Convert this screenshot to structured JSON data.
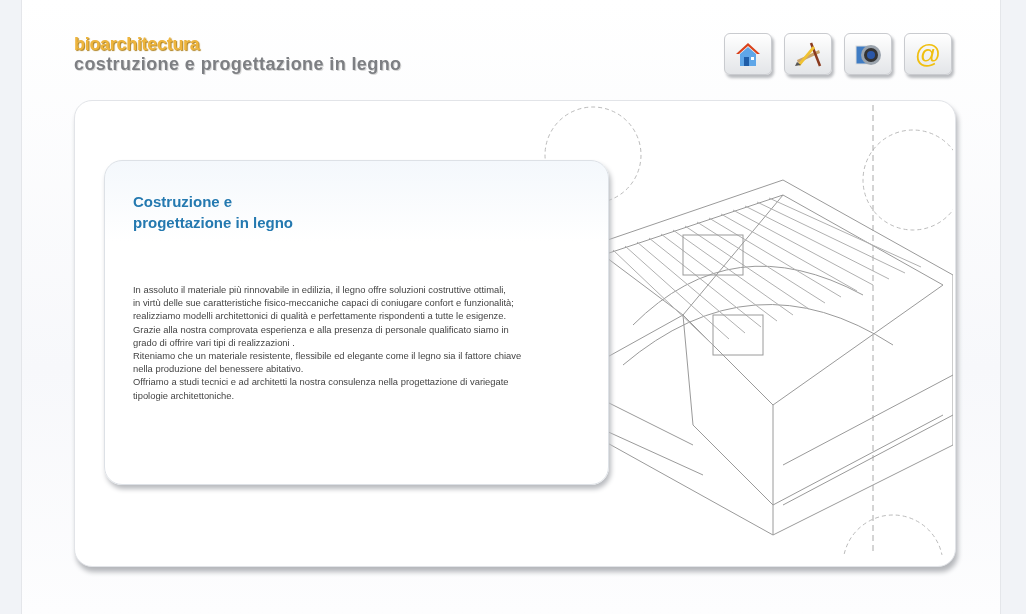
{
  "header": {
    "brand": "bioarchitectura",
    "tagline": "costruzione e progettazione in legno"
  },
  "nav": [
    {
      "kind": "house"
    },
    {
      "kind": "tools"
    },
    {
      "kind": "camera"
    },
    {
      "kind": "at",
      "glyph": "@"
    }
  ],
  "content": {
    "title_lines": [
      "Costruzione e",
      "progettazione in legno"
    ],
    "lines": [
      "In assoluto il materiale più rinnovabile in edilizia, il legno offre soluzioni costruttive ottimali,",
      "in virtù delle sue caratteristiche fisico-meccaniche capaci di coniugare confort e funzionalità;",
      "realizziamo modelli architettonici di qualità e perfettamente rispondenti a tutte le esigenze.",
      "Grazie alla nostra comprovata esperienza e alla presenza di personale qualificato siamo in",
      "grado di offrire vari tipi di realizzazioni .",
      "Riteniamo che un materiale resistente, flessibile ed elegante come il legno sia il fattore chiave",
      "nella produzione del benessere abitativo.",
      "Offriamo a studi tecnici e ad architetti la nostra consulenza nella progettazione di variegate",
      "tipologie architettoniche."
    ]
  }
}
